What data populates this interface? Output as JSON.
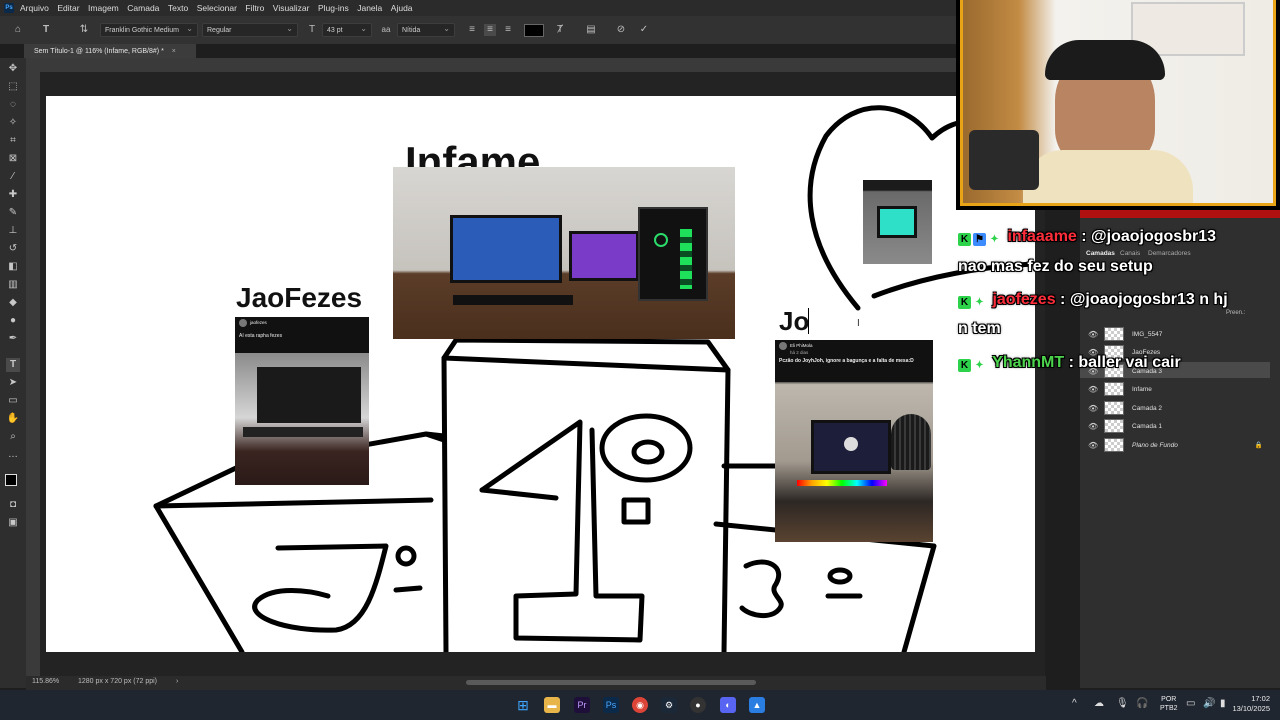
{
  "menubar": {
    "items": [
      "Arquivo",
      "Editar",
      "Imagem",
      "Camada",
      "Texto",
      "Selecionar",
      "Filtro",
      "Visualizar",
      "Plug-ins",
      "Janela",
      "Ajuda"
    ]
  },
  "options": {
    "font_family": "Franklin Gothic Medium",
    "font_style": "Regular",
    "font_size": "43 pt",
    "antialias": "Nítida",
    "text_color": "#000000"
  },
  "document": {
    "tab_title": "Sem Título-1 @ 116% (Infame, RGB/8#) *"
  },
  "canvas": {
    "labels": {
      "infame": "Infame",
      "jaofezes": "JaoFezes",
      "jo_typing": "Jo"
    },
    "podium": {
      "first": "1°",
      "second": "2°",
      "third": "3°"
    },
    "posts": {
      "jaofezes_caption": "Aí esta rapha fezes",
      "jaofezes_user": "jaofezes",
      "third_user": "Eli PhiMola",
      "third_time": "há 2 dias",
      "third_caption": "Pczão do JoyhJoh, ignore a bagunça e a falta de mesa:D"
    }
  },
  "status": {
    "zoom": "115.86%",
    "doc_info": "1280 px x 720 px (72 ppi)"
  },
  "panels": {
    "tabs": [
      "Camadas",
      "Canais",
      "Demarcadores"
    ],
    "fill_label": "Preen.:",
    "layers": [
      "IMG_5547",
      "JaoFezes",
      "Camada 3",
      "Infame",
      "Camada 2",
      "Camada 1",
      "Plano de Fundo"
    ]
  },
  "chat": [
    {
      "user": "infaaame",
      "message": " : @joaojogosbr13",
      "message2": "nao mas fez do seu setup",
      "color": "#ff2d3a"
    },
    {
      "user": "jaofezes",
      "message": " : @joaojogosbr13 n hj",
      "message2": "n tem",
      "color": "#ff2d3a"
    },
    {
      "user": "YhannMT",
      "message": " : baller vai cair",
      "color": "#4cd44c"
    }
  ],
  "taskbar": {
    "lang1": "POR",
    "lang2": "PTB2",
    "time": "17:02",
    "date": "13/10/2025"
  },
  "colors": {
    "accent": "#e8a317",
    "chat_red": "#ff2d3a",
    "chat_green": "#4cd44c"
  }
}
